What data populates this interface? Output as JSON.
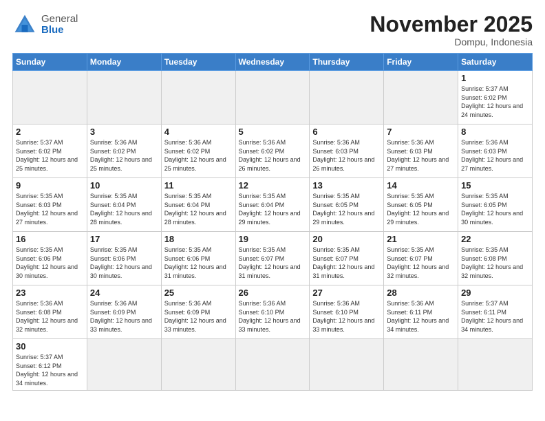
{
  "header": {
    "logo_general": "General",
    "logo_blue": "Blue",
    "month_title": "November 2025",
    "location": "Dompu, Indonesia"
  },
  "weekdays": [
    "Sunday",
    "Monday",
    "Tuesday",
    "Wednesday",
    "Thursday",
    "Friday",
    "Saturday"
  ],
  "weeks": [
    [
      {
        "day": "",
        "empty": true
      },
      {
        "day": "",
        "empty": true
      },
      {
        "day": "",
        "empty": true
      },
      {
        "day": "",
        "empty": true
      },
      {
        "day": "",
        "empty": true
      },
      {
        "day": "",
        "empty": true
      },
      {
        "day": "1",
        "sunrise": "5:37 AM",
        "sunset": "6:02 PM",
        "daylight": "12 hours and 24 minutes."
      }
    ],
    [
      {
        "day": "2",
        "sunrise": "5:37 AM",
        "sunset": "6:02 PM",
        "daylight": "12 hours and 25 minutes."
      },
      {
        "day": "3",
        "sunrise": "5:36 AM",
        "sunset": "6:02 PM",
        "daylight": "12 hours and 25 minutes."
      },
      {
        "day": "4",
        "sunrise": "5:36 AM",
        "sunset": "6:02 PM",
        "daylight": "12 hours and 25 minutes."
      },
      {
        "day": "5",
        "sunrise": "5:36 AM",
        "sunset": "6:02 PM",
        "daylight": "12 hours and 26 minutes."
      },
      {
        "day": "6",
        "sunrise": "5:36 AM",
        "sunset": "6:03 PM",
        "daylight": "12 hours and 26 minutes."
      },
      {
        "day": "7",
        "sunrise": "5:36 AM",
        "sunset": "6:03 PM",
        "daylight": "12 hours and 27 minutes."
      },
      {
        "day": "8",
        "sunrise": "5:36 AM",
        "sunset": "6:03 PM",
        "daylight": "12 hours and 27 minutes."
      }
    ],
    [
      {
        "day": "9",
        "sunrise": "5:35 AM",
        "sunset": "6:03 PM",
        "daylight": "12 hours and 27 minutes."
      },
      {
        "day": "10",
        "sunrise": "5:35 AM",
        "sunset": "6:04 PM",
        "daylight": "12 hours and 28 minutes."
      },
      {
        "day": "11",
        "sunrise": "5:35 AM",
        "sunset": "6:04 PM",
        "daylight": "12 hours and 28 minutes."
      },
      {
        "day": "12",
        "sunrise": "5:35 AM",
        "sunset": "6:04 PM",
        "daylight": "12 hours and 29 minutes."
      },
      {
        "day": "13",
        "sunrise": "5:35 AM",
        "sunset": "6:05 PM",
        "daylight": "12 hours and 29 minutes."
      },
      {
        "day": "14",
        "sunrise": "5:35 AM",
        "sunset": "6:05 PM",
        "daylight": "12 hours and 29 minutes."
      },
      {
        "day": "15",
        "sunrise": "5:35 AM",
        "sunset": "6:05 PM",
        "daylight": "12 hours and 30 minutes."
      }
    ],
    [
      {
        "day": "16",
        "sunrise": "5:35 AM",
        "sunset": "6:06 PM",
        "daylight": "12 hours and 30 minutes."
      },
      {
        "day": "17",
        "sunrise": "5:35 AM",
        "sunset": "6:06 PM",
        "daylight": "12 hours and 30 minutes."
      },
      {
        "day": "18",
        "sunrise": "5:35 AM",
        "sunset": "6:06 PM",
        "daylight": "12 hours and 31 minutes."
      },
      {
        "day": "19",
        "sunrise": "5:35 AM",
        "sunset": "6:07 PM",
        "daylight": "12 hours and 31 minutes."
      },
      {
        "day": "20",
        "sunrise": "5:35 AM",
        "sunset": "6:07 PM",
        "daylight": "12 hours and 31 minutes."
      },
      {
        "day": "21",
        "sunrise": "5:35 AM",
        "sunset": "6:07 PM",
        "daylight": "12 hours and 32 minutes."
      },
      {
        "day": "22",
        "sunrise": "5:35 AM",
        "sunset": "6:08 PM",
        "daylight": "12 hours and 32 minutes."
      }
    ],
    [
      {
        "day": "23",
        "sunrise": "5:36 AM",
        "sunset": "6:08 PM",
        "daylight": "12 hours and 32 minutes."
      },
      {
        "day": "24",
        "sunrise": "5:36 AM",
        "sunset": "6:09 PM",
        "daylight": "12 hours and 33 minutes."
      },
      {
        "day": "25",
        "sunrise": "5:36 AM",
        "sunset": "6:09 PM",
        "daylight": "12 hours and 33 minutes."
      },
      {
        "day": "26",
        "sunrise": "5:36 AM",
        "sunset": "6:10 PM",
        "daylight": "12 hours and 33 minutes."
      },
      {
        "day": "27",
        "sunrise": "5:36 AM",
        "sunset": "6:10 PM",
        "daylight": "12 hours and 33 minutes."
      },
      {
        "day": "28",
        "sunrise": "5:36 AM",
        "sunset": "6:11 PM",
        "daylight": "12 hours and 34 minutes."
      },
      {
        "day": "29",
        "sunrise": "5:37 AM",
        "sunset": "6:11 PM",
        "daylight": "12 hours and 34 minutes."
      }
    ],
    [
      {
        "day": "30",
        "sunrise": "5:37 AM",
        "sunset": "6:12 PM",
        "daylight": "12 hours and 34 minutes."
      },
      {
        "day": "",
        "empty": true
      },
      {
        "day": "",
        "empty": true
      },
      {
        "day": "",
        "empty": true
      },
      {
        "day": "",
        "empty": true
      },
      {
        "day": "",
        "empty": true
      },
      {
        "day": "",
        "empty": true
      }
    ]
  ]
}
